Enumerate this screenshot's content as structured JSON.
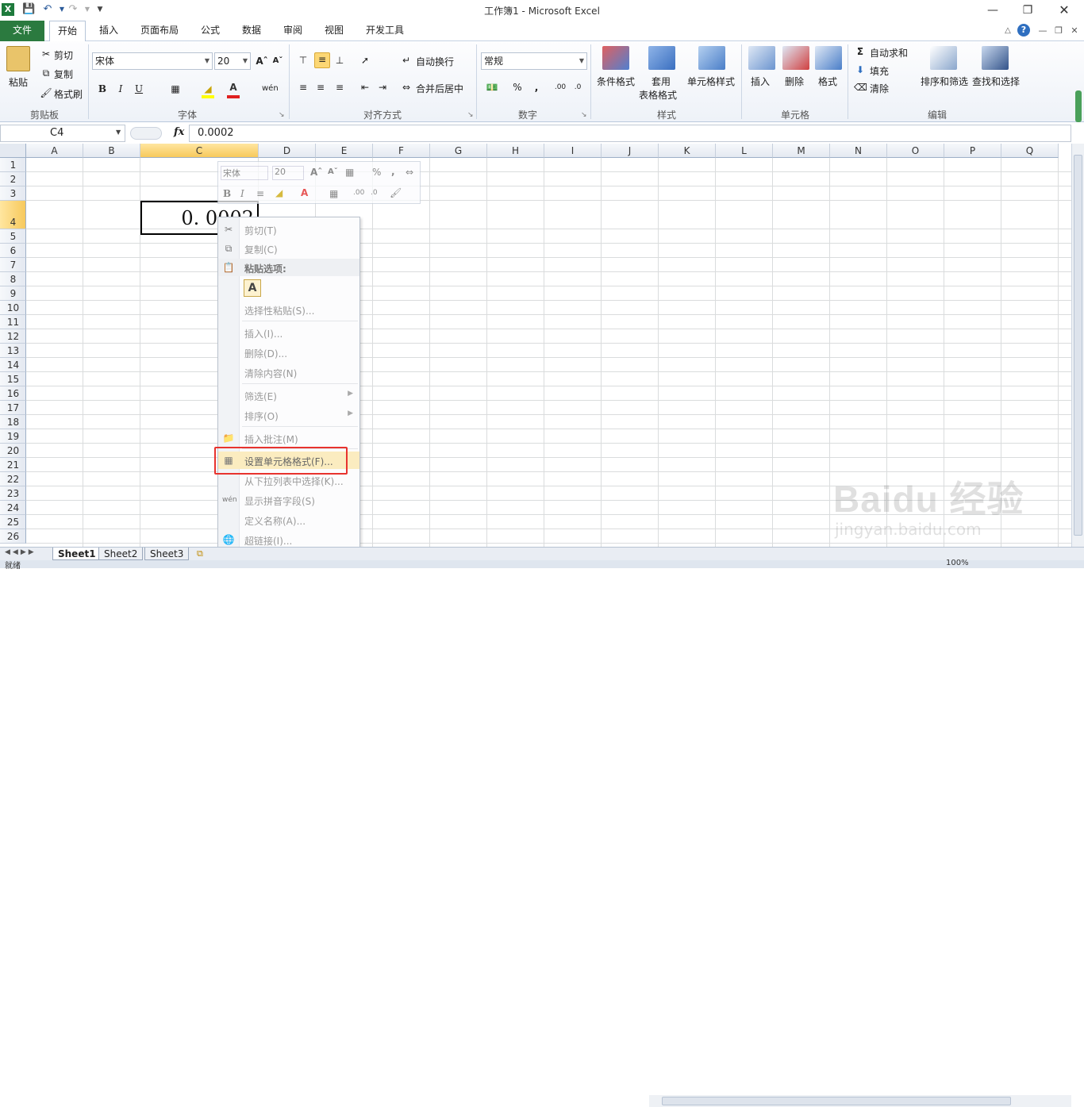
{
  "window": {
    "title": "工作簿1 - Microsoft Excel"
  },
  "ribbon_tabs": [
    "文件",
    "开始",
    "插入",
    "页面布局",
    "公式",
    "数据",
    "审阅",
    "视图",
    "开发工具"
  ],
  "ribbon": {
    "clipboard": {
      "paste": "粘贴",
      "cut": "剪切",
      "copy": "复制",
      "format_painter": "格式刷",
      "group": "剪贴板"
    },
    "font": {
      "name": "宋体",
      "size": "20",
      "group": "字体",
      "bold": "B",
      "italic": "I",
      "underline": "U"
    },
    "alignment": {
      "wrap": "自动换行",
      "merge": "合并后居中",
      "group": "对齐方式"
    },
    "number": {
      "format": "常规",
      "percent": "%",
      "comma": ",",
      "group": "数字"
    },
    "styles": {
      "conditional": "条件格式",
      "table_line1": "套用",
      "table_line2": "表格格式",
      "cell_styles": "单元格样式",
      "group": "样式"
    },
    "cells": {
      "insert": "插入",
      "delete": "删除",
      "format": "格式",
      "group": "单元格"
    },
    "editing": {
      "autosum": "自动求和",
      "fill": "填充",
      "clear": "清除",
      "sort_filter": "排序和筛选",
      "find_select": "查找和选择",
      "group": "编辑"
    }
  },
  "formula_bar": {
    "name_box": "C4",
    "fx": "fx",
    "content": "0.0002"
  },
  "columns": [
    "A",
    "B",
    "C",
    "D",
    "E",
    "F",
    "G",
    "H",
    "I",
    "J",
    "K",
    "L",
    "M",
    "N",
    "O",
    "P",
    "Q"
  ],
  "rows": [
    "1",
    "2",
    "3",
    "4",
    "5",
    "6",
    "7",
    "8",
    "9",
    "10",
    "11",
    "12",
    "13",
    "14",
    "15",
    "16",
    "17",
    "18",
    "19",
    "20",
    "21",
    "22",
    "23",
    "24",
    "25",
    "26"
  ],
  "active_cell": {
    "ref": "C4",
    "display": "0. 0002"
  },
  "mini_toolbar": {
    "font": "宋体",
    "size": "20"
  },
  "context_menu": {
    "cut": "剪切(T)",
    "copy": "复制(C)",
    "paste_options": "粘贴选项:",
    "paste_glyph": "A",
    "paste_special": "选择性粘贴(S)...",
    "insert": "插入(I)...",
    "delete": "删除(D)...",
    "clear": "清除内容(N)",
    "filter": "筛选(E)",
    "sort": "排序(O)",
    "comment": "插入批注(M)",
    "format_cells": "设置单元格格式(F)...",
    "pick_list": "从下拉列表中选择(K)...",
    "phonetic": "显示拼音字段(S)",
    "define_name": "定义名称(A)...",
    "hyperlink": "超链接(I)..."
  },
  "sheets": [
    "Sheet1",
    "Sheet2",
    "Sheet3"
  ],
  "status": {
    "ready": "就绪",
    "zoom": "100%"
  },
  "watermark": {
    "brand": "Baidu 经验",
    "url": "jingyan.baidu.com"
  },
  "colors": {
    "file_tab": "#2b7a3f",
    "highlight_box": "#e8332e",
    "selected_header": "#f7c95c"
  }
}
